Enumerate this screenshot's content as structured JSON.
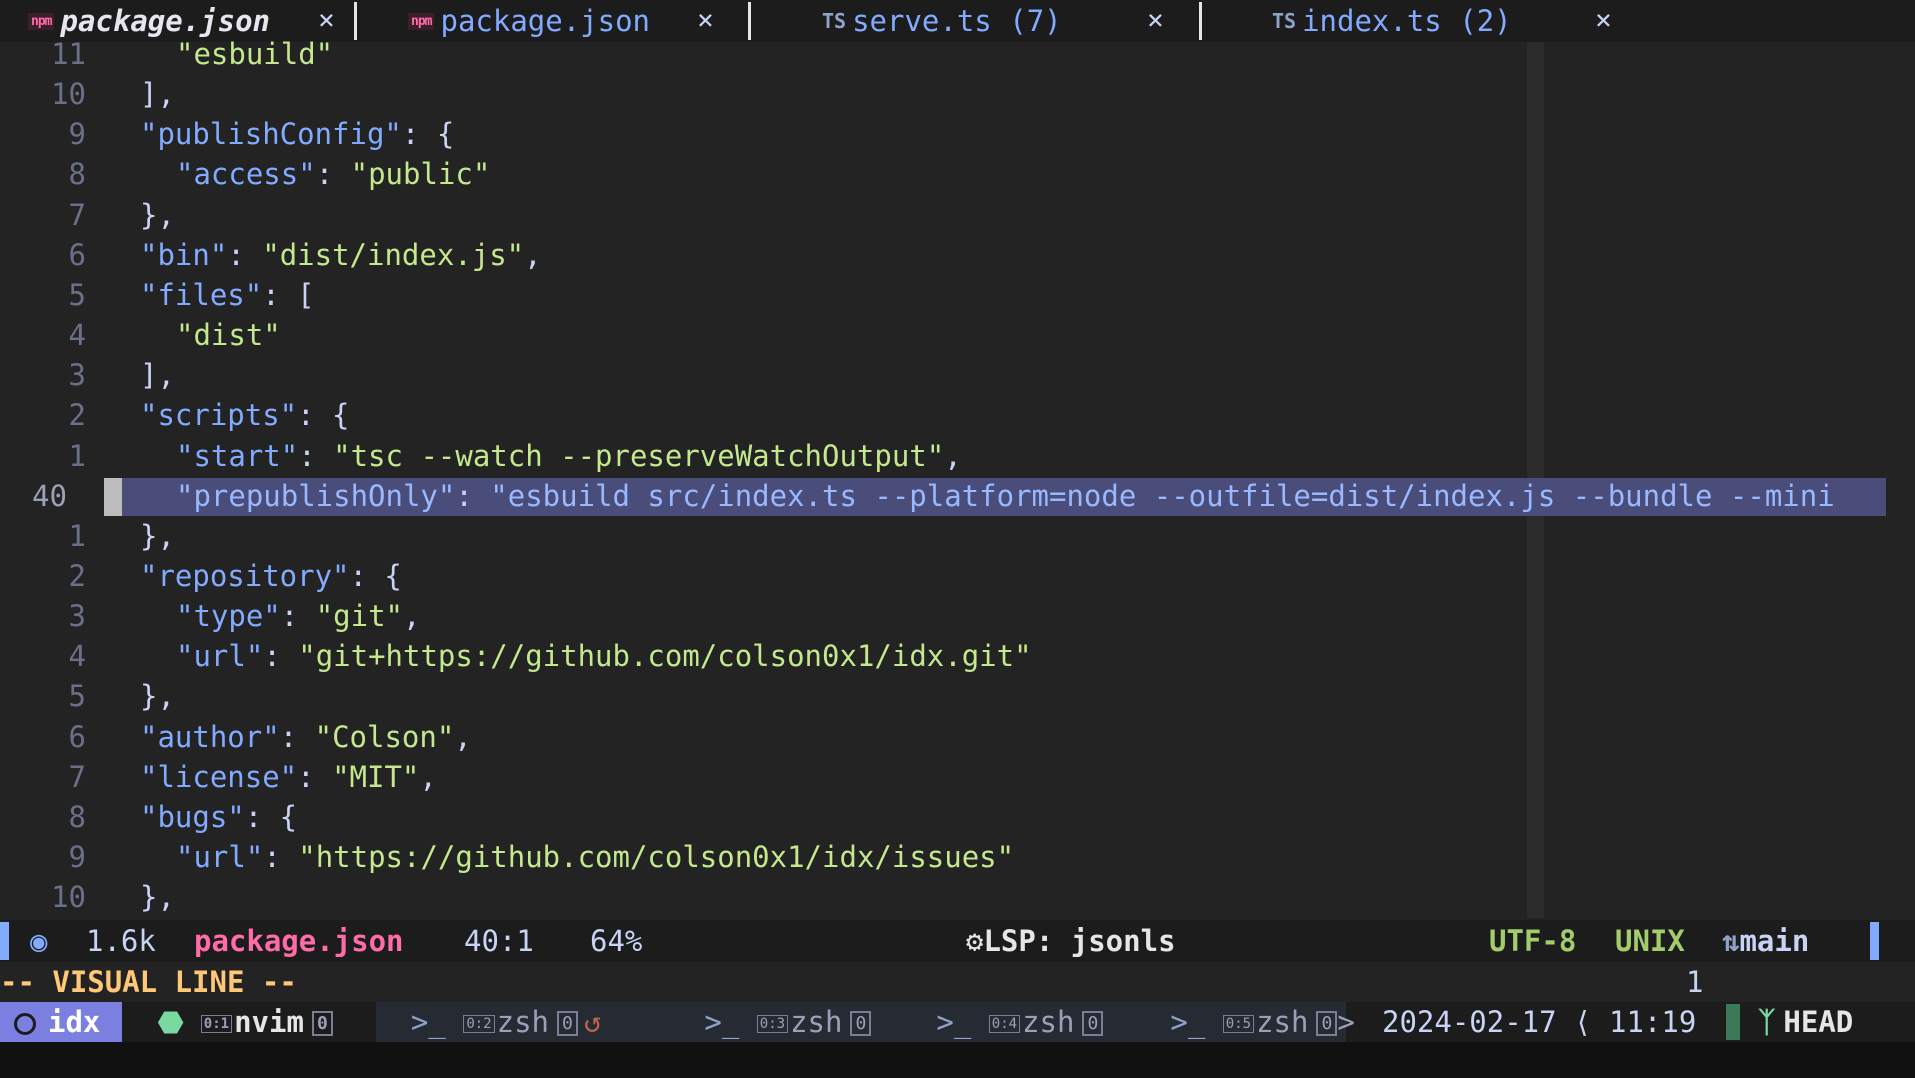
{
  "tabs": [
    {
      "icon": "npm",
      "name": "package.json",
      "close": "×",
      "active": true
    },
    {
      "icon": "npm",
      "name": "package.json",
      "close": "×"
    },
    {
      "icon": "TS",
      "name": "serve.ts (7)",
      "close": "×"
    },
    {
      "icon": "TS",
      "name": "index.ts (2)",
      "close": "×"
    }
  ],
  "lines": [
    {
      "num": "11",
      "indent": 1,
      "tokens": [
        [
          "s",
          "\"esbuild\""
        ]
      ]
    },
    {
      "num": "10",
      "indent": 0,
      "tokens": [
        [
          "p",
          "],"
        ]
      ]
    },
    {
      "num": "9",
      "indent": 0,
      "tokens": [
        [
          "k",
          "\"publishConfig\""
        ],
        [
          "p",
          ": {"
        ]
      ]
    },
    {
      "num": "8",
      "indent": 1,
      "tokens": [
        [
          "k",
          "\"access\""
        ],
        [
          "p",
          ": "
        ],
        [
          "s",
          "\"public\""
        ]
      ]
    },
    {
      "num": "7",
      "indent": 0,
      "tokens": [
        [
          "p",
          "},"
        ]
      ]
    },
    {
      "num": "6",
      "indent": 0,
      "tokens": [
        [
          "k",
          "\"bin\""
        ],
        [
          "p",
          ": "
        ],
        [
          "s",
          "\"dist/index.js\""
        ],
        [
          "p",
          ","
        ]
      ]
    },
    {
      "num": "5",
      "indent": 0,
      "tokens": [
        [
          "k",
          "\"files\""
        ],
        [
          "p",
          ": ["
        ]
      ]
    },
    {
      "num": "4",
      "indent": 1,
      "tokens": [
        [
          "s",
          "\"dist\""
        ]
      ]
    },
    {
      "num": "3",
      "indent": 0,
      "tokens": [
        [
          "p",
          "],"
        ]
      ]
    },
    {
      "num": "2",
      "indent": 0,
      "tokens": [
        [
          "k",
          "\"scripts\""
        ],
        [
          "p",
          ": {"
        ]
      ]
    },
    {
      "num": "1",
      "indent": 1,
      "tokens": [
        [
          "k",
          "\"start\""
        ],
        [
          "p",
          ": "
        ],
        [
          "s",
          "\"tsc --watch --preserveWatchOutput\""
        ],
        [
          "p",
          ","
        ]
      ]
    },
    {
      "num": "40",
      "indent": 1,
      "current": true,
      "tokens": [
        [
          "k",
          "\"prepublishOnly\""
        ],
        [
          "p",
          ": "
        ],
        [
          "s",
          "\"esbuild src/index.ts --platform=node --outfile=dist/index.js --bundle --mini"
        ]
      ]
    },
    {
      "num": "1",
      "indent": 0,
      "tokens": [
        [
          "p",
          "},"
        ]
      ]
    },
    {
      "num": "2",
      "indent": 0,
      "tokens": [
        [
          "k",
          "\"repository\""
        ],
        [
          "p",
          ": {"
        ]
      ]
    },
    {
      "num": "3",
      "indent": 1,
      "tokens": [
        [
          "k",
          "\"type\""
        ],
        [
          "p",
          ": "
        ],
        [
          "s",
          "\"git\""
        ],
        [
          "p",
          ","
        ]
      ]
    },
    {
      "num": "4",
      "indent": 1,
      "tokens": [
        [
          "k",
          "\"url\""
        ],
        [
          "p",
          ": "
        ],
        [
          "s",
          "\"git+https://github.com/colson0x1/idx.git\""
        ]
      ]
    },
    {
      "num": "5",
      "indent": 0,
      "tokens": [
        [
          "p",
          "},"
        ]
      ]
    },
    {
      "num": "6",
      "indent": 0,
      "tokens": [
        [
          "k",
          "\"author\""
        ],
        [
          "p",
          ": "
        ],
        [
          "s",
          "\"Colson\""
        ],
        [
          "p",
          ","
        ]
      ]
    },
    {
      "num": "7",
      "indent": 0,
      "tokens": [
        [
          "k",
          "\"license\""
        ],
        [
          "p",
          ": "
        ],
        [
          "s",
          "\"MIT\""
        ],
        [
          "p",
          ","
        ]
      ]
    },
    {
      "num": "8",
      "indent": 0,
      "tokens": [
        [
          "k",
          "\"bugs\""
        ],
        [
          "p",
          ": {"
        ]
      ]
    },
    {
      "num": "9",
      "indent": 1,
      "tokens": [
        [
          "k",
          "\"url\""
        ],
        [
          "p",
          ": "
        ],
        [
          "s",
          "\"https://github.com/colson0x1/idx/issues\""
        ]
      ]
    },
    {
      "num": "10",
      "indent": 0,
      "tokens": [
        [
          "p",
          "},"
        ]
      ]
    }
  ],
  "status": {
    "size": "1.6k",
    "filename": "package.json",
    "position": "40:1",
    "percent": "64%",
    "lsp": "LSP: jsonls",
    "encoding": "UTF-8",
    "format": "UNIX",
    "branch": "main"
  },
  "cmdline": {
    "mode": "-- VISUAL LINE --",
    "count": "1"
  },
  "tmux": {
    "session": "idx",
    "windows": [
      {
        "index": "0:1",
        "name": "nvim",
        "flag": "0"
      },
      {
        "index": "0:2",
        "name": "zsh",
        "flag": "0"
      },
      {
        "index": "0:3",
        "name": "zsh",
        "flag": "0"
      },
      {
        "index": "0:4",
        "name": "zsh",
        "flag": "0"
      },
      {
        "index": "0:5",
        "name": "zsh",
        "flag": "0"
      }
    ],
    "date": "2024-02-17",
    "time": "11:19",
    "head": "HEAD"
  },
  "colors": {
    "background": "#232323",
    "keyword": "#82aaff",
    "string": "#c3e88d",
    "selection": "#4a4d79",
    "filename": "#ff6ca8",
    "mode": "#ffc777",
    "session": "#7b7fe0"
  }
}
